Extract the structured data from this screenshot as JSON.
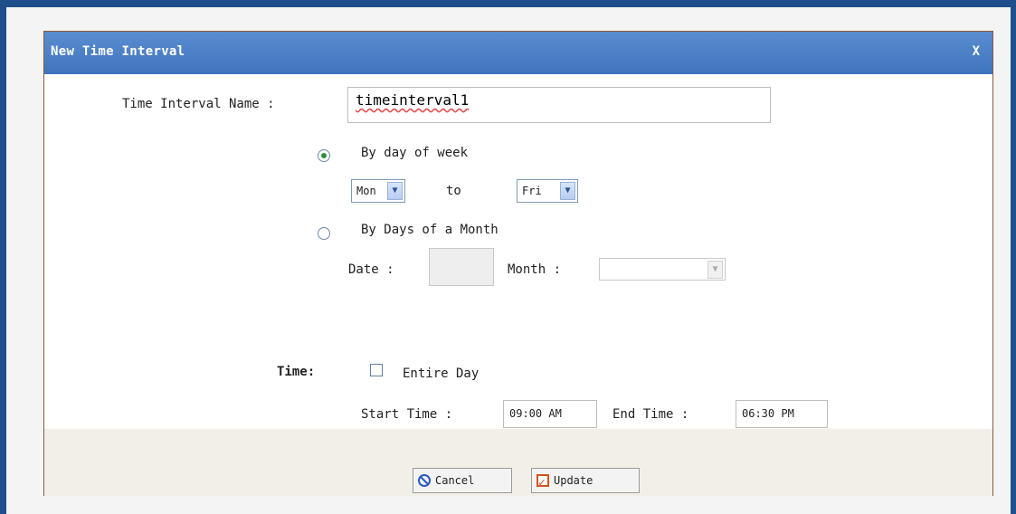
{
  "dialog": {
    "title": "New Time Interval",
    "close_label": "X"
  },
  "form": {
    "name_label": "Time Interval Name :",
    "name_value": "timeinterval1",
    "by_day_of_week": {
      "label": "By day of week",
      "selected": true,
      "from_value": "Mon",
      "to_label": "to",
      "to_value": "Fri"
    },
    "by_days_of_month": {
      "label": "By Days of a Month",
      "selected": false,
      "date_label": "Date :",
      "date_value": "",
      "month_label": "Month :",
      "month_value": ""
    },
    "time": {
      "label": "Time:",
      "entire_day_label": "Entire Day",
      "entire_day_checked": false,
      "start_label": "Start Time :",
      "start_value": "09:00 AM",
      "end_label": "End Time :",
      "end_value": "06:30 PM"
    }
  },
  "buttons": {
    "cancel": "Cancel",
    "update": "Update"
  },
  "icons": {
    "close": "close-icon",
    "radio_selected": "radio-selected-icon",
    "dropdown": "chevron-down-icon",
    "cancel": "cancel-icon",
    "update": "checkbox-check-icon"
  },
  "colors": {
    "titlebar": "#4a80c8",
    "frame": "#1f4e8c",
    "dialog_border": "#8a5a3a",
    "footer": "#f2efe8"
  }
}
